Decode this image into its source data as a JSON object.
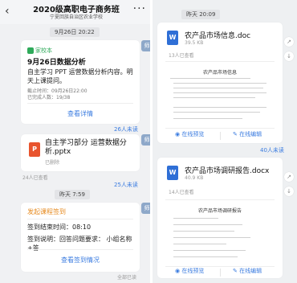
{
  "header": {
    "back_icon": "chevron-left-icon",
    "title": "2020级高职电子商务班",
    "subtitle": "宁夏回族自治区农业学校",
    "more_icon": "ellipsis-icon"
  },
  "left": {
    "chip_date1": "9月26日 20:22",
    "homework": {
      "tag": "家校本",
      "title": "9月26日数据分析",
      "body": "自主学习 PPT 运营数据分析内容。明天上课提问。",
      "deadline": "截止时间：09月26日22:00",
      "progress": "已完成人数：19/38",
      "link": "查看详情",
      "unread": "26人未读"
    },
    "file_card": {
      "icon": "P",
      "name": "自主学习部分 运营数据分析.pptx",
      "status": "已删除",
      "read": "24人已查看",
      "unread": "25人未读"
    },
    "chip_date2": "昨天 7:59",
    "checkin": {
      "tag": "发起课程签到",
      "end_time": "签到结束时间：08:10",
      "desc": "签到说明：回答问题要求： 小组名称+答",
      "link": "查看签到情况",
      "footer": "全部已读"
    }
  },
  "right": {
    "chip_date": "昨天 20:09",
    "doc1": {
      "icon": "W",
      "name": "农产品市场信息.doc",
      "size": "39.5 KB",
      "read": "13人已查看",
      "preview_title": "农产品市场信息",
      "preview_btn": "在线预览",
      "edit_btn": "在线编辑",
      "unread": "40人未读"
    },
    "doc2": {
      "icon": "W",
      "name": "农产品市场调研报告.docx",
      "size": "40.9 KB",
      "read": "14人已查看",
      "preview_title": "农产品市场调研报告",
      "preview_btn": "在线预览",
      "edit_btn": "在线编辑"
    }
  }
}
